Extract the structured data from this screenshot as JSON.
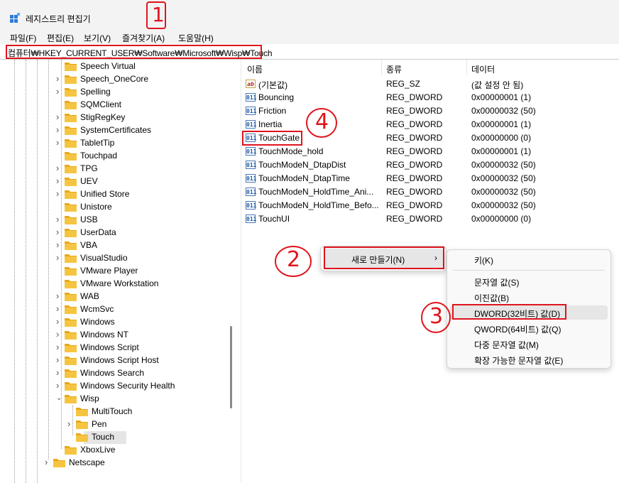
{
  "window": {
    "title": "레지스트리 편집기"
  },
  "menu": [
    "파일(F)",
    "편집(E)",
    "보기(V)",
    "즐겨찾기(A)",
    "도움말(H)"
  ],
  "address": "컴퓨터₩HKEY_CURRENT_USER₩Software₩Microsoft₩Wisp₩Touch",
  "tree": {
    "items": [
      {
        "label": "Speech Virtual",
        "level": 1,
        "expander": "none"
      },
      {
        "label": "Speech_OneCore",
        "level": 1,
        "expander": "collapsed"
      },
      {
        "label": "Spelling",
        "level": 1,
        "expander": "collapsed"
      },
      {
        "label": "SQMClient",
        "level": 1,
        "expander": "none"
      },
      {
        "label": "StigRegKey",
        "level": 1,
        "expander": "collapsed"
      },
      {
        "label": "SystemCertificates",
        "level": 1,
        "expander": "collapsed"
      },
      {
        "label": "TabletTip",
        "level": 1,
        "expander": "collapsed"
      },
      {
        "label": "Touchpad",
        "level": 1,
        "expander": "none"
      },
      {
        "label": "TPG",
        "level": 1,
        "expander": "collapsed"
      },
      {
        "label": "UEV",
        "level": 1,
        "expander": "collapsed"
      },
      {
        "label": "Unified Store",
        "level": 1,
        "expander": "collapsed"
      },
      {
        "label": "Unistore",
        "level": 1,
        "expander": "none"
      },
      {
        "label": "USB",
        "level": 1,
        "expander": "collapsed"
      },
      {
        "label": "UserData",
        "level": 1,
        "expander": "collapsed"
      },
      {
        "label": "VBA",
        "level": 1,
        "expander": "collapsed"
      },
      {
        "label": "VisualStudio",
        "level": 1,
        "expander": "collapsed"
      },
      {
        "label": "VMware Player",
        "level": 1,
        "expander": "none"
      },
      {
        "label": "VMware Workstation",
        "level": 1,
        "expander": "none"
      },
      {
        "label": "WAB",
        "level": 1,
        "expander": "collapsed"
      },
      {
        "label": "WcmSvc",
        "level": 1,
        "expander": "collapsed"
      },
      {
        "label": "Windows",
        "level": 1,
        "expander": "collapsed"
      },
      {
        "label": "Windows NT",
        "level": 1,
        "expander": "collapsed"
      },
      {
        "label": "Windows Script",
        "level": 1,
        "expander": "collapsed"
      },
      {
        "label": "Windows Script Host",
        "level": 1,
        "expander": "collapsed"
      },
      {
        "label": "Windows Search",
        "level": 1,
        "expander": "collapsed"
      },
      {
        "label": "Windows Security Health",
        "level": 1,
        "expander": "collapsed"
      },
      {
        "label": "Wisp",
        "level": 1,
        "expander": "expanded"
      },
      {
        "label": "MultiTouch",
        "level": 2,
        "expander": "none"
      },
      {
        "label": "Pen",
        "level": 2,
        "expander": "collapsed"
      },
      {
        "label": "Touch",
        "level": 2,
        "expander": "none",
        "selected": true
      },
      {
        "label": "XboxLive",
        "level": 1,
        "expander": "none"
      },
      {
        "label": "Netscape",
        "level": 0,
        "expander": "collapsed"
      }
    ]
  },
  "list": {
    "headers": {
      "name": "이름",
      "type": "종류",
      "data": "데이터"
    },
    "rows": [
      {
        "icon": "ab",
        "name": "(기본값)",
        "type": "REG_SZ",
        "data": "(값 설정 안 됨)"
      },
      {
        "icon": "dword",
        "name": "Bouncing",
        "type": "REG_DWORD",
        "data": "0x00000001 (1)"
      },
      {
        "icon": "dword",
        "name": "Friction",
        "type": "REG_DWORD",
        "data": "0x00000032 (50)"
      },
      {
        "icon": "dword",
        "name": "Inertia",
        "type": "REG_DWORD",
        "data": "0x00000001 (1)"
      },
      {
        "icon": "dword",
        "name": "TouchGate",
        "type": "REG_DWORD",
        "data": "0x00000000 (0)"
      },
      {
        "icon": "dword",
        "name": "TouchMode_hold",
        "type": "REG_DWORD",
        "data": "0x00000001 (1)"
      },
      {
        "icon": "dword",
        "name": "TouchModeN_DtapDist",
        "type": "REG_DWORD",
        "data": "0x00000032 (50)"
      },
      {
        "icon": "dword",
        "name": "TouchModeN_DtapTime",
        "type": "REG_DWORD",
        "data": "0x00000032 (50)"
      },
      {
        "icon": "dword",
        "name": "TouchModeN_HoldTime_Ani...",
        "type": "REG_DWORD",
        "data": "0x00000032 (50)"
      },
      {
        "icon": "dword",
        "name": "TouchModeN_HoldTime_Befo...",
        "type": "REG_DWORD",
        "data": "0x00000032 (50)"
      },
      {
        "icon": "dword",
        "name": "TouchUI",
        "type": "REG_DWORD",
        "data": "0x00000000 (0)"
      }
    ]
  },
  "context_menu": {
    "new_label": "새로 만들기(N)",
    "submenu": {
      "key": "키(K)",
      "string": "문자열 값(S)",
      "binary": "이진값(B)",
      "dword": "DWORD(32비트) 값(D)",
      "qword": "QWORD(64비트) 값(Q)",
      "multi_string": "다중 문자열 값(M)",
      "expandable_string": "확장 가능한 문자열 값(E)"
    }
  },
  "annotations": {
    "step1": "1",
    "step2": "2",
    "step3": "3",
    "step4": "4"
  },
  "colors": {
    "annotation": "#e0141e",
    "folder": "#f5c542",
    "selection": "#e5e5e5"
  }
}
